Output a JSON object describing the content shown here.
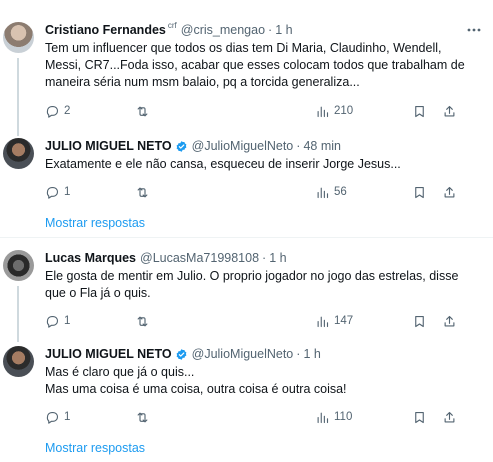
{
  "tweets": [
    {
      "name": "Cristiano Fernandes",
      "name_suffix": "crf",
      "handle": "@cris_mengao",
      "dot": "·",
      "time": "1 h",
      "lines": [
        "Tem um influencer que todos os dias tem Di Maria, Claudinho, Wendell,",
        "Messi, CR7...Foda isso, acabar que esses colocam todos que trabalham de",
        "maneira séria num msm balaio, pq a torcida generaliza..."
      ],
      "replies": "2",
      "retweets": "",
      "views": "210"
    },
    {
      "name": "JULIO MIGUEL NETO",
      "handle": "@JulioMiguelNeto",
      "dot": "·",
      "time": "48 min",
      "lines": [
        "Exatamente e ele não cansa, esqueceu de inserir Jorge Jesus..."
      ],
      "replies": "1",
      "retweets": "",
      "views": "56",
      "show_replies": "Mostrar respostas"
    },
    {
      "name": "Lucas Marques",
      "handle": "@LucasMa71998108",
      "dot": "·",
      "time": "1 h",
      "lines": [
        "Ele gosta de mentir em Julio. O proprio jogador no jogo das estrelas, disse",
        "que o Fla já o quis."
      ],
      "replies": "1",
      "retweets": "",
      "views": "147"
    },
    {
      "name": "JULIO MIGUEL NETO",
      "handle": "@JulioMiguelNeto",
      "dot": "·",
      "time": "1 h",
      "lines": [
        "Mas é claro que já o quis...",
        "Mas uma coisa é uma coisa, outra coisa é outra coisa!"
      ],
      "replies": "1",
      "retweets": "",
      "views": "110",
      "show_replies": "Mostrar respostas"
    }
  ],
  "colors": {
    "accent": "#1d9bf0",
    "muted": "#536471",
    "text": "#0f1419",
    "separator": "#eff3f4"
  },
  "icons": [
    "more-icon",
    "reply-icon",
    "retweet-icon",
    "views-icon",
    "bookmark-icon",
    "share-icon",
    "verified-badge-icon"
  ]
}
